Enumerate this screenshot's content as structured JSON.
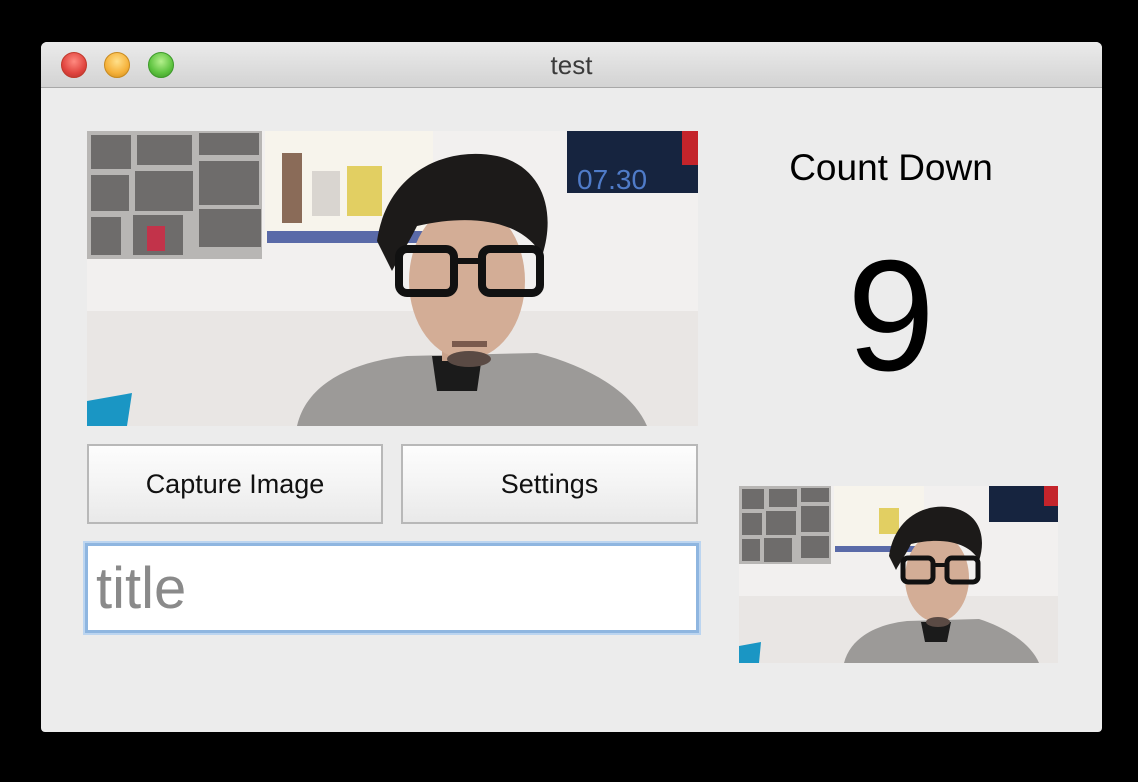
{
  "window": {
    "title": "test"
  },
  "controls": {
    "close_icon": "close-icon",
    "minimize_icon": "minimize-icon",
    "zoom_icon": "zoom-icon"
  },
  "buttons": {
    "capture_label": "Capture Image",
    "settings_label": "Settings"
  },
  "title_field": {
    "value": "",
    "placeholder": "title"
  },
  "countdown": {
    "label": "Count Down",
    "value": "9"
  },
  "preview": {
    "icon": "camera-preview",
    "poster_date": "07.30"
  },
  "colors": {
    "window_bg": "#ececec",
    "focus_ring": "#8fb6e0",
    "close": "#e0443e",
    "minimize": "#f5b13a",
    "zoom": "#5cc23e"
  }
}
